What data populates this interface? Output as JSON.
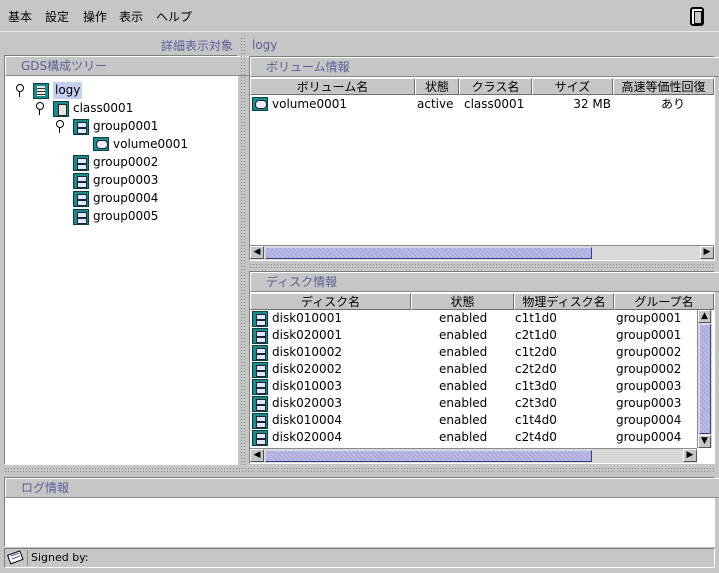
{
  "menu": {
    "items": [
      "基本",
      "設定",
      "操作",
      "表示",
      "ヘルプ"
    ]
  },
  "left_panel": {
    "header_label": "詳細表示対象",
    "tree_title": "GDS構成ツリー",
    "tree": [
      {
        "label": "logy",
        "icon": "node-icon",
        "level": 0,
        "expander": true,
        "selected": true
      },
      {
        "label": "class0001",
        "icon": "class-icon",
        "level": 1,
        "expander": true
      },
      {
        "label": "group0001",
        "icon": "group-icon",
        "level": 2,
        "expander": true
      },
      {
        "label": "volume0001",
        "icon": "volume-icon",
        "level": 3,
        "expander": false
      },
      {
        "label": "group0002",
        "icon": "group-icon",
        "level": 2,
        "expander": false
      },
      {
        "label": "group0003",
        "icon": "group-icon",
        "level": 2,
        "expander": false
      },
      {
        "label": "group0004",
        "icon": "group-icon",
        "level": 2,
        "expander": false
      },
      {
        "label": "group0005",
        "icon": "group-icon",
        "level": 2,
        "expander": false
      }
    ]
  },
  "right_panel": {
    "target_label": "logy",
    "volume_section": {
      "title": "ボリューム情報",
      "columns": [
        "ボリューム名",
        "状態",
        "クラス名",
        "サイズ",
        "高速等価性回復"
      ],
      "rows": [
        [
          "volume0001",
          "active",
          "class0001",
          "32 MB",
          "あり"
        ]
      ]
    },
    "disk_section": {
      "title": "ディスク情報",
      "columns": [
        "ディスク名",
        "状態",
        "物理ディスク名",
        "グループ名"
      ],
      "rows": [
        [
          "disk010001",
          "enabled",
          "c1t1d0",
          "group0001"
        ],
        [
          "disk020001",
          "enabled",
          "c2t1d0",
          "group0001"
        ],
        [
          "disk010002",
          "enabled",
          "c1t2d0",
          "group0002"
        ],
        [
          "disk020002",
          "enabled",
          "c2t2d0",
          "group0002"
        ],
        [
          "disk010003",
          "enabled",
          "c1t3d0",
          "group0003"
        ],
        [
          "disk020003",
          "enabled",
          "c2t3d0",
          "group0003"
        ],
        [
          "disk010004",
          "enabled",
          "c1t4d0",
          "group0004"
        ],
        [
          "disk020004",
          "enabled",
          "c2t4d0",
          "group0004"
        ]
      ]
    }
  },
  "log_section": {
    "title": "ログ情報",
    "content": ""
  },
  "status_bar": {
    "text": "Signed by:",
    "icon": "certificate-icon"
  },
  "colors": {
    "section_title_text": "#5b5f9a",
    "selection": "#c6cff0",
    "thumb": "#a9abdd",
    "icon_teal": "#1b8a88"
  }
}
